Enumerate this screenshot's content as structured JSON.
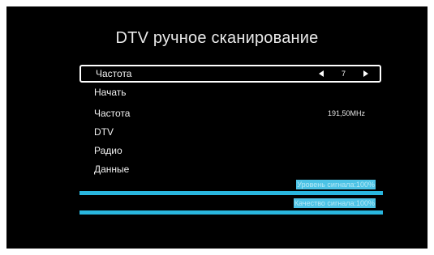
{
  "title": "DTV ручное сканирование",
  "menu": {
    "frequency_select": {
      "label": "Частота",
      "value": "7"
    },
    "start_label": "Начать",
    "frequency_info": {
      "label": "Частота",
      "value": "191,50MHz"
    },
    "dtv_label": "DTV",
    "radio_label": "Радио",
    "data_label": "Данные"
  },
  "meters": {
    "signal_level": {
      "label": "Уровень сигнала:100%",
      "percent": 100
    },
    "signal_quality": {
      "label": "Качество сигнала:100%",
      "percent": 100
    }
  },
  "colors": {
    "background": "#000000",
    "accent": "#29b6de",
    "text": "#f0f0f0"
  }
}
